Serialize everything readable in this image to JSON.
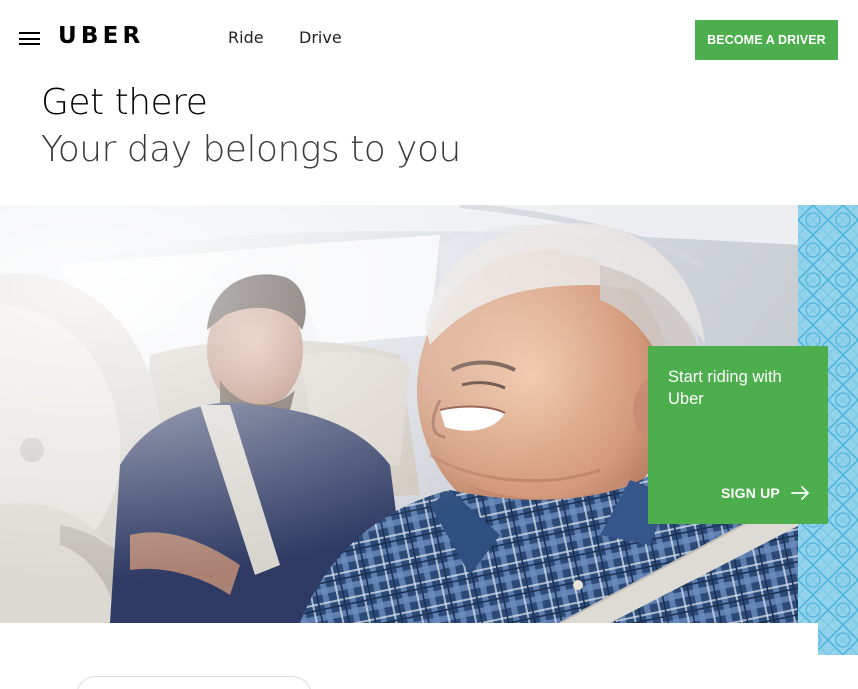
{
  "header": {
    "logo": "UBER",
    "nav": [
      {
        "label": "Ride"
      },
      {
        "label": "Drive"
      }
    ],
    "cta_label": "BECOME A DRIVER",
    "menu_icon": "hamburger-menu-icon"
  },
  "hero": {
    "headline": "Get there",
    "subheadline": "Your day belongs to you"
  },
  "card": {
    "title": "Start riding with Uber",
    "action_label": "SIGN UP",
    "action_icon": "arrow-right-icon"
  },
  "colors": {
    "accent": "#4cae4c",
    "pattern": "#4fb7df"
  }
}
